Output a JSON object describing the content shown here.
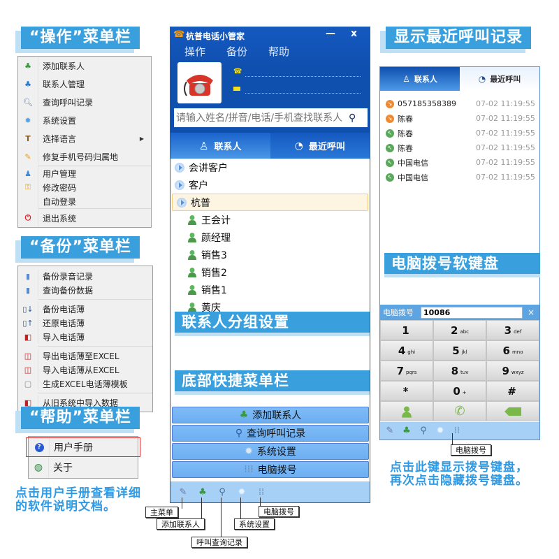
{
  "banners": {
    "operate_menu": "“操作”菜单栏",
    "backup_menu": "“备份”菜单栏",
    "help_menu": "“帮助”菜单栏",
    "recent_calls": "显示最近呼叫记录",
    "contact_groups": "联系人分组设置",
    "bottom_quick_menu": "底部快捷菜单栏",
    "softkeyboard": "电脑拨号软键盘"
  },
  "operate_menu": {
    "items": [
      {
        "label": "添加联系人",
        "icon": "add-contact-icon"
      },
      {
        "label": "联系人管理",
        "icon": "contacts-manage-icon"
      },
      {
        "label": "查询呼叫记录",
        "icon": "search-icon"
      },
      {
        "label": "系统设置",
        "icon": "gear-icon"
      },
      {
        "label": "选择语言",
        "icon": "language-icon",
        "submenu": true
      },
      {
        "label": "修复手机号码归属地",
        "icon": "repair-icon"
      },
      {
        "label": "用户管理",
        "icon": "user-icon"
      },
      {
        "label": "修改密码",
        "icon": "key-icon"
      },
      {
        "label": "自动登录",
        "icon": ""
      },
      {
        "label": "退出系统",
        "icon": "power-icon"
      }
    ]
  },
  "backup_menu": {
    "items": [
      {
        "label": "备份录音记录"
      },
      {
        "label": "查询备份数据"
      },
      {
        "label": "备份电话薄"
      },
      {
        "label": "还原电话薄"
      },
      {
        "label": "导入电话薄"
      },
      {
        "label": "导出电话薄至EXCEL"
      },
      {
        "label": "导入电话薄从EXCEL"
      },
      {
        "label": "生成EXCEL电话薄模板"
      },
      {
        "label": "从旧系统中导入数据"
      }
    ]
  },
  "help_menu": {
    "items": [
      {
        "label": "用户手册",
        "highlighted": true
      },
      {
        "label": "关于"
      }
    ],
    "note_line1": "点击用户手册查看详细",
    "note_line2": "的软件说明文档。"
  },
  "app": {
    "title": "杭普电话小管家",
    "minimize": "—",
    "close": "x",
    "menu": [
      "操作",
      "备份",
      "帮助"
    ],
    "search_placeholder": "请输入姓名/拼音/电话/手机查找联系人",
    "tabs": [
      "联系人",
      "最近呼叫"
    ],
    "groups": [
      "会讲客户",
      "客户",
      "杭普"
    ],
    "contacts": [
      "王会计",
      "颜经理",
      "销售3",
      "销售2",
      "销售1",
      "黄庆"
    ],
    "quick_buttons": [
      "添加联系人",
      "查询呼叫记录",
      "系统设置",
      "电脑拨号"
    ],
    "bottom_icons": [
      "main-menu-icon",
      "add-contact-icon",
      "search-icon",
      "gear-icon",
      "dialpad-icon"
    ]
  },
  "callouts": {
    "main_menu": "主菜单",
    "add_contact": "添加联系人",
    "call_search": "呼叫查询记录",
    "settings": "系统设置",
    "dialer": "电脑拨号"
  },
  "recent": {
    "tabs": [
      "联系人",
      "最近呼叫"
    ],
    "calls": [
      {
        "name": "057185358389",
        "time": "07-02 11:19:55",
        "type": "incoming",
        "color": "#f08a30"
      },
      {
        "name": "陈春",
        "time": "07-02 11:19:55",
        "type": "incoming",
        "color": "#f08a30"
      },
      {
        "name": "陈春",
        "time": "07-02 11:19:55",
        "type": "outgoing",
        "color": "#5aa85a"
      },
      {
        "name": "陈春",
        "time": "07-02 11:19:55",
        "type": "outgoing",
        "color": "#5aa85a"
      },
      {
        "name": "中国电信",
        "time": "07-02 11:19:55",
        "type": "outgoing",
        "color": "#5aa85a"
      },
      {
        "name": "中国电信",
        "time": "07-02 11:19:55",
        "type": "outgoing",
        "color": "#5aa85a"
      }
    ]
  },
  "dialer": {
    "label": "电脑拨号",
    "value": "10086",
    "close": "×",
    "keys": [
      {
        "d": "1",
        "s": ""
      },
      {
        "d": "2",
        "s": "abc"
      },
      {
        "d": "3",
        "s": "def"
      },
      {
        "d": "4",
        "s": "ghi"
      },
      {
        "d": "5",
        "s": "jkl"
      },
      {
        "d": "6",
        "s": "mno"
      },
      {
        "d": "7",
        "s": "pqrs"
      },
      {
        "d": "8",
        "s": "tuv"
      },
      {
        "d": "9",
        "s": "wxyz"
      },
      {
        "d": "*",
        "s": ""
      },
      {
        "d": "0",
        "s": "+"
      },
      {
        "d": "#",
        "s": ""
      }
    ],
    "callout": "电脑拨号",
    "note_line1": "点击此键显示拨号键盘，",
    "note_line2": "再次点击隐藏拨号键盘。"
  },
  "colors": {
    "banner": "#3aa0dd",
    "window_blue": "#0f4fae",
    "quick_button": "#7fbcf6",
    "note_text": "#2e9ae6"
  }
}
